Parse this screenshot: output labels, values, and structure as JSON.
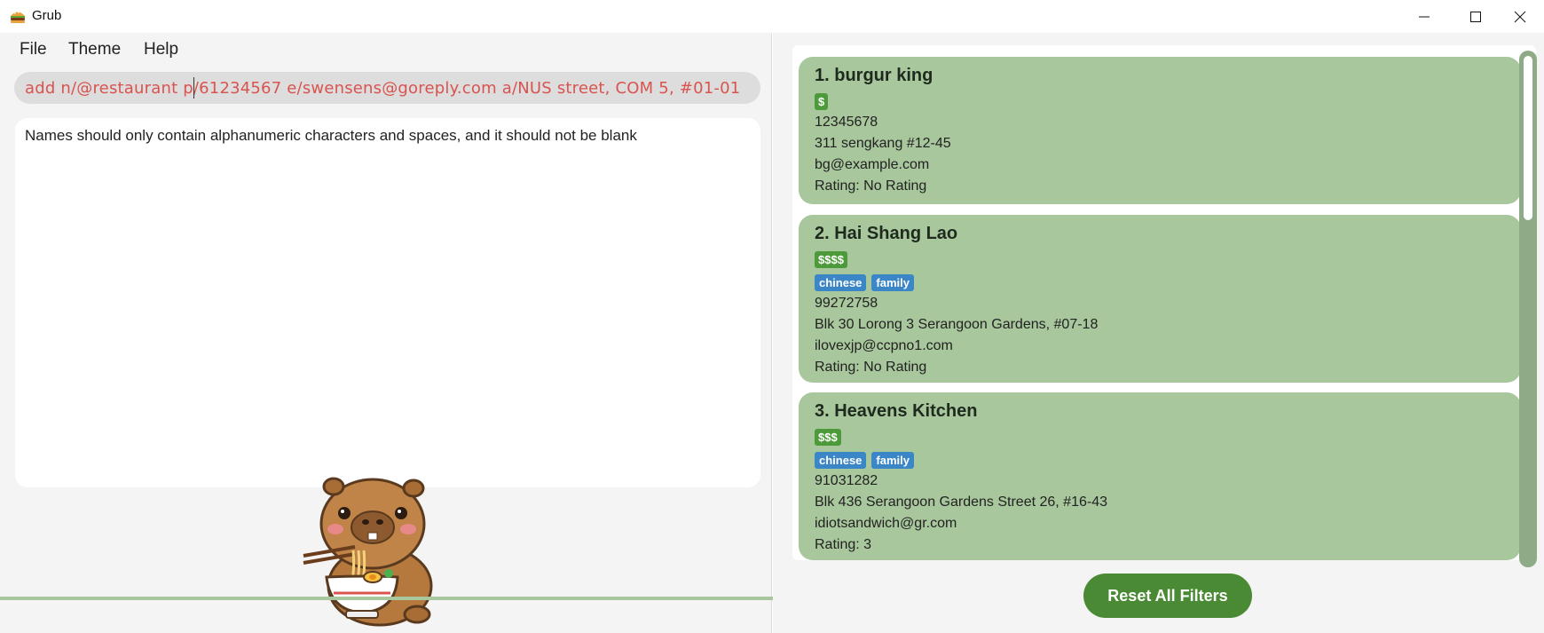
{
  "window": {
    "title": "Grub"
  },
  "menu": {
    "file": "File",
    "theme": "Theme",
    "help": "Help"
  },
  "command": {
    "value": "add n/@restaurant p/61234567 e/swensens@goreply.com a/NUS street, COM 5, #01-01"
  },
  "result": {
    "text": "Names should only contain alphanumeric characters and spaces, and it should not be blank"
  },
  "restaurants": [
    {
      "name": "1. burgur king",
      "price": "$",
      "tags": [],
      "phone": "12345678",
      "address": "311 sengkang #12-45",
      "email": "bg@example.com",
      "rating": "Rating: No Rating"
    },
    {
      "name": "2. Hai Shang Lao",
      "price": "$$$$",
      "tags": [
        "chinese",
        "family"
      ],
      "phone": "99272758",
      "address": "Blk 30 Lorong 3 Serangoon Gardens, #07-18",
      "email": "ilovexjp@ccpno1.com",
      "rating": "Rating: No Rating"
    },
    {
      "name": "3. Heavens Kitchen",
      "price": "$$$",
      "tags": [
        "chinese",
        "family"
      ],
      "phone": "91031282",
      "address": "Blk 436 Serangoon Gardens Street 26, #16-43",
      "email": "idiotsandwich@gr.com",
      "rating": "Rating: 3"
    }
  ],
  "reset_button": {
    "label": "Reset All Filters"
  },
  "colors": {
    "card": "#a8c79c",
    "price_badge": "#4c9a3a",
    "tag_badge": "#3b86c6",
    "error_text": "#d9534f",
    "button": "#4a8a34"
  },
  "icons": {
    "app": "burger-icon",
    "minimize": "minimize-icon",
    "maximize": "maximize-icon",
    "close": "close-icon",
    "mascot": "capybara-eating-noodles"
  }
}
